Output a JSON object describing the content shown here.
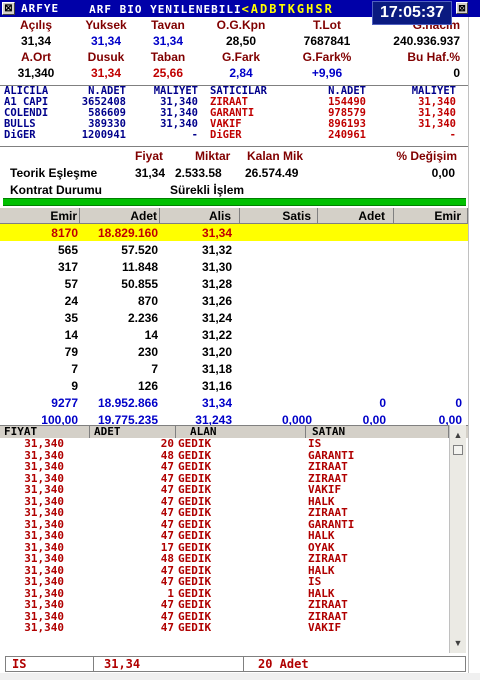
{
  "titlebar": {
    "close_glyph": "⊠",
    "symbol": "ARFYE",
    "name": "ARF BIO YENILENEBILI",
    "ticker": "<ADBTKGHSR",
    "time": "17:05:37"
  },
  "summary": {
    "row1_headers": [
      "Açılış",
      "Yuksek",
      "Tavan",
      "O.G.Kpn",
      "T.Lot",
      "G.hacim"
    ],
    "row1_values": [
      "31,34",
      "31,34",
      "31,34",
      "28,50",
      "7687841",
      "240.936.937"
    ],
    "row2_headers": [
      "A.Ort",
      "Dusuk",
      "Taban",
      "G.Fark",
      "G.Fark%",
      "Bu Haf.%"
    ],
    "row2_values": [
      "31,340",
      "31,34",
      "25,66",
      "2,84",
      "+9,96",
      "0"
    ]
  },
  "colors": {
    "title_bg": "#0000a8",
    "highlight": "#ffff00",
    "bid_red": "#c00000",
    "blue": "#0000c8",
    "green_bar": "#00c000"
  },
  "broker": {
    "headers": [
      "ALICILA",
      "N.ADET",
      "MALIYET",
      "SATICILAR",
      "N.ADET",
      "MALIYET"
    ],
    "rows": [
      [
        "A1 CAPI",
        "3652408",
        "31,340",
        "ZIRAAT",
        "154490",
        "31,340"
      ],
      [
        "COLENDI",
        "586609",
        "31,340",
        "GARANTI",
        "978579",
        "31,340"
      ],
      [
        "BULLS",
        "389330",
        "31,340",
        "VAKIF",
        "896193",
        "31,340"
      ],
      [
        "DiGER",
        "1200941",
        "-",
        "DiGER",
        "240961",
        "-"
      ]
    ]
  },
  "info": {
    "head_fiyat": "Fiyat",
    "head_miktar": "Miktar",
    "head_kalan": "Kalan Mik",
    "head_degisim": "% Değişim",
    "teorik_label": "Teorik Eşleşme",
    "teorik_fiyat": "31,34",
    "teorik_miktar": "2.533.58",
    "teorik_kalan": "26.574.49",
    "teorik_degisim": "0,00",
    "kontrat_label": "Kontrat Durumu",
    "kontrat_value": "Sürekli İşlem"
  },
  "depth": {
    "headers": [
      "Emir",
      "Adet",
      "Alis",
      "Satis",
      "Adet",
      "Emir"
    ],
    "rows": [
      [
        "8170",
        "18.829.160",
        "31,34",
        "",
        "",
        ""
      ],
      [
        "565",
        "57.520",
        "31,32",
        "",
        "",
        ""
      ],
      [
        "317",
        "11.848",
        "31,30",
        "",
        "",
        ""
      ],
      [
        "57",
        "50.855",
        "31,28",
        "",
        "",
        ""
      ],
      [
        "24",
        "870",
        "31,26",
        "",
        "",
        ""
      ],
      [
        "35",
        "2.236",
        "31,24",
        "",
        "",
        ""
      ],
      [
        "14",
        "14",
        "31,22",
        "",
        "",
        ""
      ],
      [
        "79",
        "230",
        "31,20",
        "",
        "",
        ""
      ],
      [
        "7",
        "7",
        "31,18",
        "",
        "",
        ""
      ],
      [
        "9",
        "126",
        "31,16",
        "",
        "",
        ""
      ]
    ],
    "total1": [
      "9277",
      "18.952.866",
      "31,34",
      "",
      "0",
      "0"
    ],
    "total2": [
      "100,00",
      "19.775.235",
      "31,243",
      "0,000",
      "0,00",
      "0,00"
    ]
  },
  "trades": {
    "headers": [
      "FIYAT",
      "ADET",
      "ALAN",
      "SATAN"
    ],
    "rows": [
      [
        "31,340",
        "20",
        "GEDIK",
        "IS"
      ],
      [
        "31,340",
        "48",
        "GEDIK",
        "GARANTI"
      ],
      [
        "31,340",
        "47",
        "GEDIK",
        "ZIRAAT"
      ],
      [
        "31,340",
        "47",
        "GEDIK",
        "ZIRAAT"
      ],
      [
        "31,340",
        "47",
        "GEDIK",
        "VAKIF"
      ],
      [
        "31,340",
        "47",
        "GEDIK",
        "HALK"
      ],
      [
        "31,340",
        "47",
        "GEDIK",
        "ZIRAAT"
      ],
      [
        "31,340",
        "47",
        "GEDIK",
        "GARANTI"
      ],
      [
        "31,340",
        "47",
        "GEDIK",
        "HALK"
      ],
      [
        "31,340",
        "17",
        "GEDIK",
        "OYAK"
      ],
      [
        "31,340",
        "48",
        "GEDIK",
        "ZIRAAT"
      ],
      [
        "31,340",
        "47",
        "GEDIK",
        "HALK"
      ],
      [
        "31,340",
        "47",
        "GEDIK",
        "IS"
      ],
      [
        "31,340",
        "1",
        "GEDIK",
        "HALK"
      ],
      [
        "31,340",
        "47",
        "GEDIK",
        "ZIRAAT"
      ],
      [
        "31,340",
        "47",
        "GEDIK",
        "ZIRAAT"
      ],
      [
        "31,340",
        "47",
        "GEDIK",
        "VAKIF"
      ]
    ]
  },
  "scroll": {
    "up_glyph": "▲",
    "down_glyph": "▼"
  },
  "status": {
    "broker": "IS",
    "price": "31,34",
    "qty": "20 Adet"
  }
}
